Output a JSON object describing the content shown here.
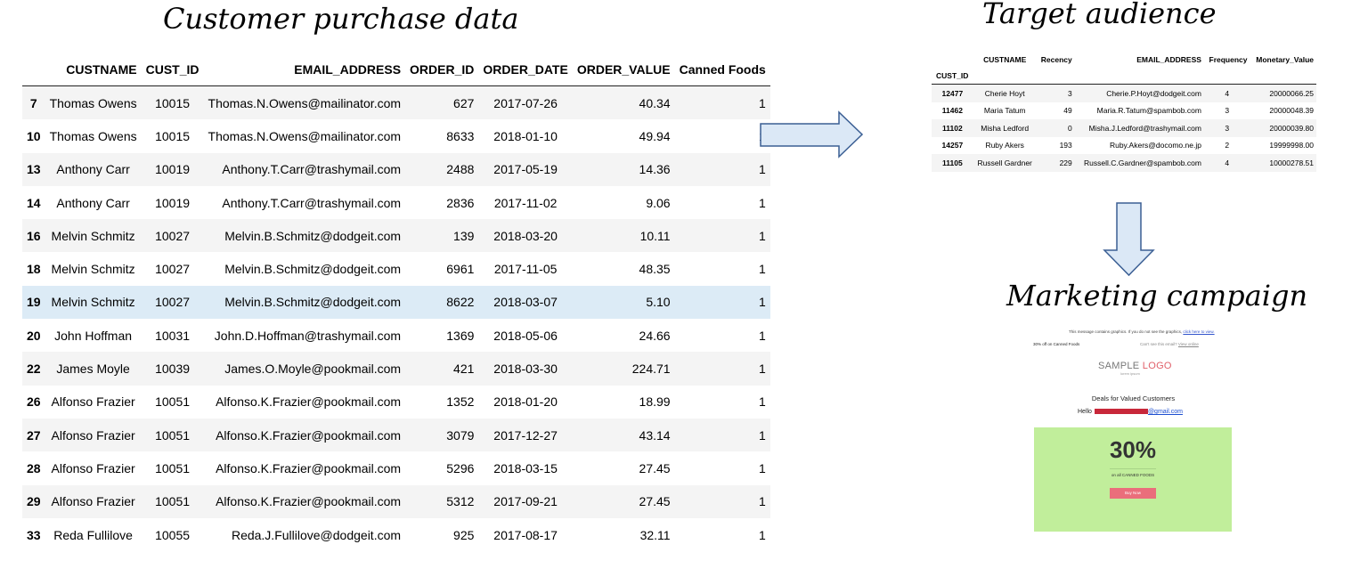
{
  "headings": {
    "left": "Customer purchase data",
    "target": "Target audience",
    "campaign": "Marketing campaign"
  },
  "purchase_table": {
    "columns": [
      "",
      "CUSTNAME",
      "CUST_ID",
      "EMAIL_ADDRESS",
      "ORDER_ID",
      "ORDER_DATE",
      "ORDER_VALUE",
      "Canned Foods"
    ],
    "rows": [
      [
        "7",
        "Thomas Owens",
        "10015",
        "Thomas.N.Owens@mailinator.com",
        "627",
        "2017-07-26",
        "40.34",
        "1"
      ],
      [
        "10",
        "Thomas Owens",
        "10015",
        "Thomas.N.Owens@mailinator.com",
        "8633",
        "2018-01-10",
        "49.94",
        "1"
      ],
      [
        "13",
        "Anthony Carr",
        "10019",
        "Anthony.T.Carr@trashymail.com",
        "2488",
        "2017-05-19",
        "14.36",
        "1"
      ],
      [
        "14",
        "Anthony Carr",
        "10019",
        "Anthony.T.Carr@trashymail.com",
        "2836",
        "2017-11-02",
        "9.06",
        "1"
      ],
      [
        "16",
        "Melvin Schmitz",
        "10027",
        "Melvin.B.Schmitz@dodgeit.com",
        "139",
        "2018-03-20",
        "10.11",
        "1"
      ],
      [
        "18",
        "Melvin Schmitz",
        "10027",
        "Melvin.B.Schmitz@dodgeit.com",
        "6961",
        "2017-11-05",
        "48.35",
        "1"
      ],
      [
        "19",
        "Melvin Schmitz",
        "10027",
        "Melvin.B.Schmitz@dodgeit.com",
        "8622",
        "2018-03-07",
        "5.10",
        "1"
      ],
      [
        "20",
        "John Hoffman",
        "10031",
        "John.D.Hoffman@trashymail.com",
        "1369",
        "2018-05-06",
        "24.66",
        "1"
      ],
      [
        "22",
        "James Moyle",
        "10039",
        "James.O.Moyle@pookmail.com",
        "421",
        "2018-03-30",
        "224.71",
        "1"
      ],
      [
        "26",
        "Alfonso Frazier",
        "10051",
        "Alfonso.K.Frazier@pookmail.com",
        "1352",
        "2018-01-20",
        "18.99",
        "1"
      ],
      [
        "27",
        "Alfonso Frazier",
        "10051",
        "Alfonso.K.Frazier@pookmail.com",
        "3079",
        "2017-12-27",
        "43.14",
        "1"
      ],
      [
        "28",
        "Alfonso Frazier",
        "10051",
        "Alfonso.K.Frazier@pookmail.com",
        "5296",
        "2018-03-15",
        "27.45",
        "1"
      ],
      [
        "29",
        "Alfonso Frazier",
        "10051",
        "Alfonso.K.Frazier@pookmail.com",
        "5312",
        "2017-09-21",
        "27.45",
        "1"
      ],
      [
        "33",
        "Reda Fullilove",
        "10055",
        "Reda.J.Fullilove@dodgeit.com",
        "925",
        "2017-08-17",
        "32.11",
        "1"
      ]
    ],
    "highlighted_row": 6
  },
  "target_table": {
    "columns": [
      "",
      "CUSTNAME",
      "Recency",
      "EMAIL_ADDRESS",
      "Frequency",
      "Monetary_Value"
    ],
    "index_name": "CUST_ID",
    "rows": [
      [
        "12477",
        "Cherie Hoyt",
        "3",
        "Cherie.P.Hoyt@dodgeit.com",
        "4",
        "20000066.25"
      ],
      [
        "11462",
        "Maria Tatum",
        "49",
        "Maria.R.Tatum@spambob.com",
        "3",
        "20000048.39"
      ],
      [
        "11102",
        "Misha Ledford",
        "0",
        "Misha.J.Ledford@trashymail.com",
        "3",
        "20000039.80"
      ],
      [
        "14257",
        "Ruby Akers",
        "193",
        "Ruby.Akers@docomo.ne.jp",
        "2",
        "19999998.00"
      ],
      [
        "11105",
        "Russell Gardner",
        "229",
        "Russell.C.Gardner@spambob.com",
        "4",
        "10000278.51"
      ]
    ]
  },
  "email": {
    "notice": "This message contains graphics. If you do not see the graphics,",
    "notice_link": "click here to view.",
    "subject": "30% off on Canned Foods",
    "view_online_prefix": "Can't see this email?",
    "view_online_link": "View online",
    "logo_sample": "SAMPLE ",
    "logo_word": "LOGO",
    "logo_sub": "lorem ipsum",
    "deals_title": "Deals for Valued Customers",
    "hello": "Hello",
    "email_suffix": "@gmail.com",
    "promo_percent": "30%",
    "promo_sub": "on all CANNED FOODS",
    "buy_label": "Buy Now"
  },
  "colors": {
    "highlight_row": "#dcebf6",
    "promo_bg": "#c1ee9b",
    "buy_button": "#ea6e7b",
    "arrow_fill": "#dbe8f6",
    "arrow_stroke": "#3b5f94"
  }
}
